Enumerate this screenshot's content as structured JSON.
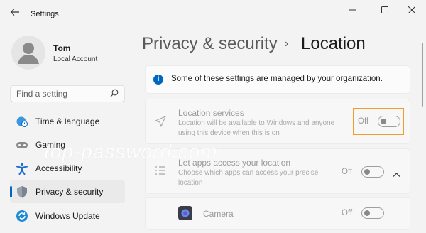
{
  "window": {
    "title": "Settings",
    "icons": {
      "back": "back-arrow-icon",
      "minimize": "minimize-icon",
      "maximize": "maximize-icon",
      "close": "close-icon"
    }
  },
  "account": {
    "name": "Tom",
    "type": "Local Account"
  },
  "search": {
    "placeholder": "Find a setting",
    "icon": "search-icon"
  },
  "nav": {
    "items": [
      {
        "label": "Time & language",
        "icon": "globe-clock-icon"
      },
      {
        "label": "Gaming",
        "icon": "gamepad-icon"
      },
      {
        "label": "Accessibility",
        "icon": "accessibility-icon"
      },
      {
        "label": "Privacy & security",
        "icon": "shield-icon",
        "selected": true
      },
      {
        "label": "Windows Update",
        "icon": "sync-icon"
      }
    ]
  },
  "breadcrumb": {
    "parent": "Privacy & security",
    "separator": "›",
    "current": "Location"
  },
  "banner": {
    "text": "Some of these settings are managed by your organization.",
    "icon": "info-icon"
  },
  "location_services": {
    "title": "Location services",
    "description": "Location will be available to Windows and anyone using this device when this is on",
    "toggle_label": "Off",
    "icon": "location-arrow-icon"
  },
  "apps_access": {
    "title": "Let apps access your location",
    "description": "Choose which apps can access your precise location",
    "toggle_label": "Off",
    "icon": "list-icon",
    "expand_icon": "chevron-up-icon"
  },
  "camera": {
    "title": "Camera",
    "toggle_label": "Off",
    "icon": "camera-app-icon"
  },
  "watermark": "top-password.com",
  "colors": {
    "accent": "#0067c0",
    "highlight": "#f39b2d"
  }
}
